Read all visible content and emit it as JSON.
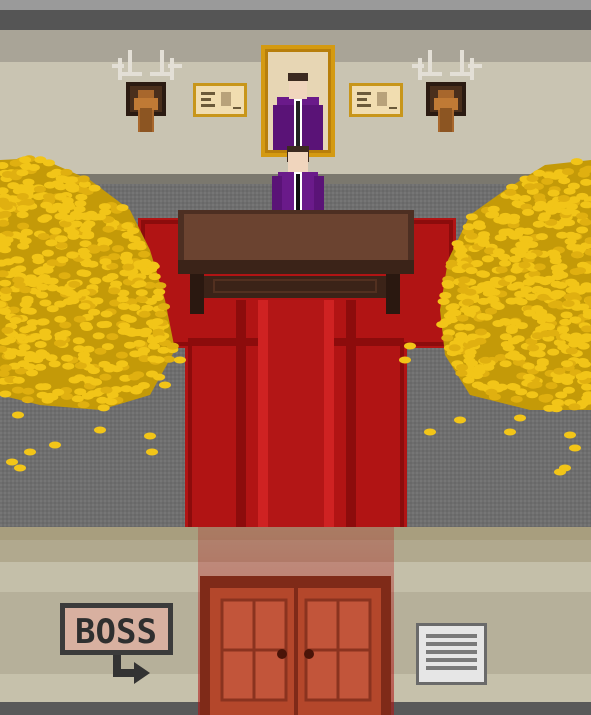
{
  "scene": {
    "type": "pixel-art boss office",
    "portrait_subject": "boss-portrait",
    "npc": "boss-character"
  },
  "signs": {
    "boss_sign_text": "BOSS"
  },
  "icons": {
    "antlers_left": "deer-trophy-icon",
    "antlers_right": "deer-trophy-icon",
    "certificate_left": "certificate-icon",
    "certificate_right": "certificate-icon",
    "arrow": "arrow-right-icon",
    "vent": "wall-vent-icon"
  },
  "colors": {
    "carpet_red": "#b11414",
    "carpet_dark": "#7a0808",
    "gold": "#f2c518",
    "gold_shadow": "#c49a08",
    "suit_purple": "#6a1a8a",
    "desk_brown": "#6b4330",
    "door_red": "#b4472b",
    "wall_beige": "#c9c3b0",
    "floor_gray": "#6f6f6f"
  }
}
